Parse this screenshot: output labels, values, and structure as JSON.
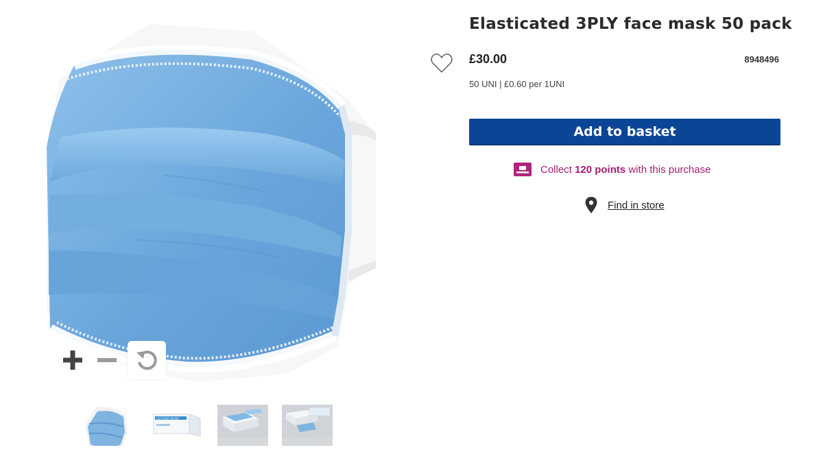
{
  "product": {
    "title": "Elasticated 3PLY face mask 50 pack",
    "price": "£30.00",
    "sku": "8948496",
    "unit_price": "50 UNI | £0.60 per 1UNI"
  },
  "actions": {
    "add_to_basket": "Add to basket",
    "find_in_store": "Find in store"
  },
  "points": {
    "prefix": "Collect ",
    "amount": "120 points",
    "suffix": " with this purchase"
  },
  "gallery": {
    "thumbnails": [
      "mask",
      "mask-box",
      "mask-box-open",
      "mask-box-and-mask"
    ],
    "thumb_box_text": "LQ FACE MASK"
  },
  "icons": {
    "wishlist": "heart-icon",
    "zoom_in": "plus-icon",
    "zoom_out": "minus-icon",
    "reset": "rotate-icon",
    "points": "loyalty-card-icon",
    "store": "map-pin-icon"
  },
  "colors": {
    "primary_button": "#0b4596",
    "points_accent": "#a61c74",
    "mask_blue": "#7fb3e0"
  }
}
